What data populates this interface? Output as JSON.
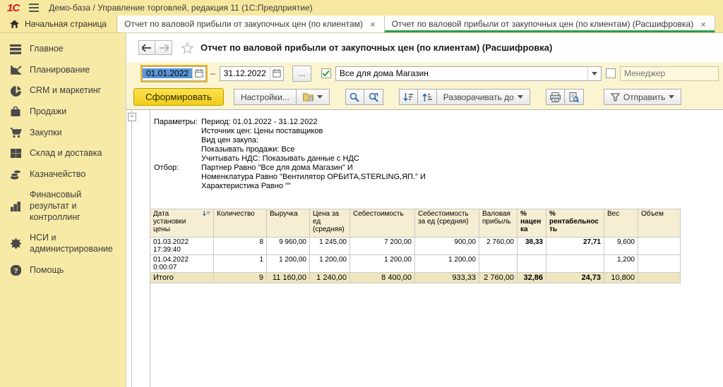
{
  "colors": {
    "brand_yellow": "#f6e8a0",
    "pale_yellow": "#fbf4d0",
    "accent_green": "#24a148",
    "button_yellow": "#f2ce1b",
    "selection_blue": "#5b96d6",
    "logo_red": "#d6131c",
    "table_header_bg": "#f6eed2",
    "total_row_bg": "#efe6bf"
  },
  "window": {
    "title": "Демо-база / Управление торговлей, редакция 11  (1С:Предприятие)"
  },
  "tabs": {
    "home": "Начальная страница",
    "close_glyph": "×",
    "items": [
      {
        "label": "Отчет по валовой прибыли от закупочных цен (по клиентам)"
      },
      {
        "label": "Отчет по валовой прибыли от закупочных цен (по клиентам) (Расшифровка)"
      }
    ]
  },
  "sidebar": {
    "items": [
      {
        "label": "Главное"
      },
      {
        "label": "Планирование"
      },
      {
        "label": "CRM и маркетинг"
      },
      {
        "label": "Продажи"
      },
      {
        "label": "Закупки"
      },
      {
        "label": "Склад и доставка"
      },
      {
        "label": "Казначейство"
      },
      {
        "label": "Финансовый результат и контроллинг"
      },
      {
        "label": "НСИ и администрирование"
      },
      {
        "label": "Помощь"
      }
    ]
  },
  "report": {
    "title": "Отчет по валовой прибыли от закупочных цен (по клиентам) (Расшифровка)",
    "period_from": "01.01.2022",
    "period_to": "31.12.2022",
    "dash": "–",
    "more": "...",
    "partner": "Все для дома Магазин",
    "manager_placeholder": "Менеджер"
  },
  "toolbar": {
    "generate": "Сформировать",
    "settings": "Настройки...",
    "expand_to": "Разворачивать до",
    "send": "Отправить"
  },
  "params": {
    "label": "Параметры:",
    "lines": [
      "Период: 01.01.2022 - 31.12.2022",
      "Источник цен: Цены поставщиков",
      "Вид цен закупа:",
      "Показывать продажи: Все",
      "Учитывать НДС: Показывать данные с НДС"
    ],
    "filter_label": "Отбор:",
    "filter_lines": [
      "Партнер Равно \"Все для дома Магазин\" И",
      "Номенклатура Равно \"Вентилятор ОРБИТА,STERLING,ЯП.\" И",
      "Характеристика Равно \"\""
    ]
  },
  "chart_data": {
    "type": "table",
    "title": "Отчет по валовой прибыли от закупочных цен (по клиентам) (Расшифровка)",
    "columns": [
      "Дата установки цены",
      "Количество",
      "Выручка",
      "Цена за ед (средняя)",
      "Себестоимость",
      "Себестоимость за ед (средняя)",
      "Валовая прибыль",
      "% наценка",
      "% рентабельность",
      "Вес",
      "Объем"
    ],
    "rows": [
      [
        "01.03.2022 17:39:40",
        "8",
        "9 960,00",
        "1 245,00",
        "7 200,00",
        "900,00",
        "2 760,00",
        "38,33",
        "27,71",
        "9,600",
        ""
      ],
      [
        "01.04.2022 0:00:07",
        "1",
        "1 200,00",
        "1 200,00",
        "1 200,00",
        "1 200,00",
        "",
        "",
        "",
        "1,200",
        ""
      ]
    ],
    "total": [
      "Итого",
      "9",
      "11 160,00",
      "1 240,00",
      "8 400,00",
      "933,33",
      "2 760,00",
      "32,86",
      "24,73",
      "10,800",
      ""
    ]
  }
}
